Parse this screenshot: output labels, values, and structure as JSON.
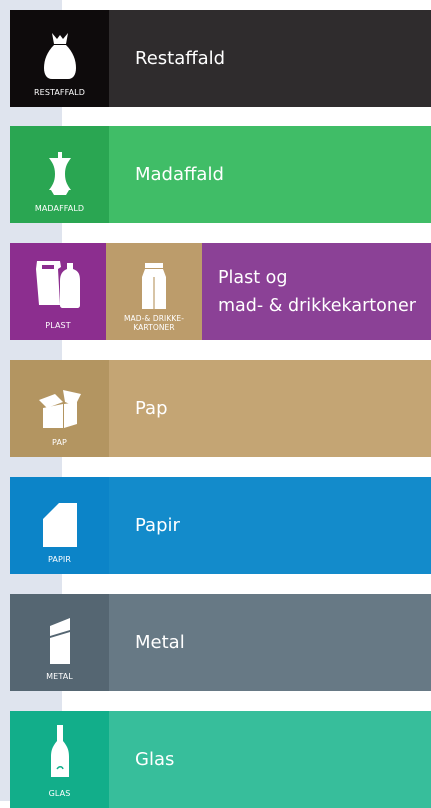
{
  "colors": {
    "restaffald_tile": "#0e0b0c",
    "restaffald_band": "#2f2c2d",
    "madaffald_tile": "#2aa652",
    "madaffald_band": "#40bd67",
    "plast_tile": "#8c2e8f",
    "karton_tile": "#bc9c6b",
    "plast_band": "#8b4196",
    "pap_tile": "#b39561",
    "pap_band": "#c4a574",
    "papir_tile": "#0c84c8",
    "papir_band": "#138bcb",
    "metal_tile": "#556672",
    "metal_band": "#677985",
    "glas_tile": "#12ae8a",
    "glas_band": "#37be9b",
    "side_strip": "#dfe4ee"
  },
  "categories": [
    {
      "id": "restaffald",
      "caption": "RESTAFFALD",
      "label": "Restaffald",
      "icon": "trash-bag-icon"
    },
    {
      "id": "madaffald",
      "caption": "MADAFFALD",
      "label": "Madaffald",
      "icon": "apple-core-icon"
    },
    {
      "id": "plast",
      "caption": "PLAST",
      "caption2_line1": "MAD-& DRIKKE-",
      "caption2_line2": "KARTONER",
      "label_line1": "Plast og",
      "label_line2": "mad- & drikkekartoner",
      "icon": "plastic-bottles-icon",
      "icon2": "milk-carton-icon"
    },
    {
      "id": "pap",
      "caption": "PAP",
      "label": "Pap",
      "icon": "cardboard-box-icon"
    },
    {
      "id": "papir",
      "caption": "PAPIR",
      "label": "Papir",
      "icon": "paper-sheet-icon"
    },
    {
      "id": "metal",
      "caption": "METAL",
      "label": "Metal",
      "icon": "tin-can-icon"
    },
    {
      "id": "glas",
      "caption": "GLAS",
      "label": "Glas",
      "icon": "glass-bottle-icon"
    }
  ]
}
